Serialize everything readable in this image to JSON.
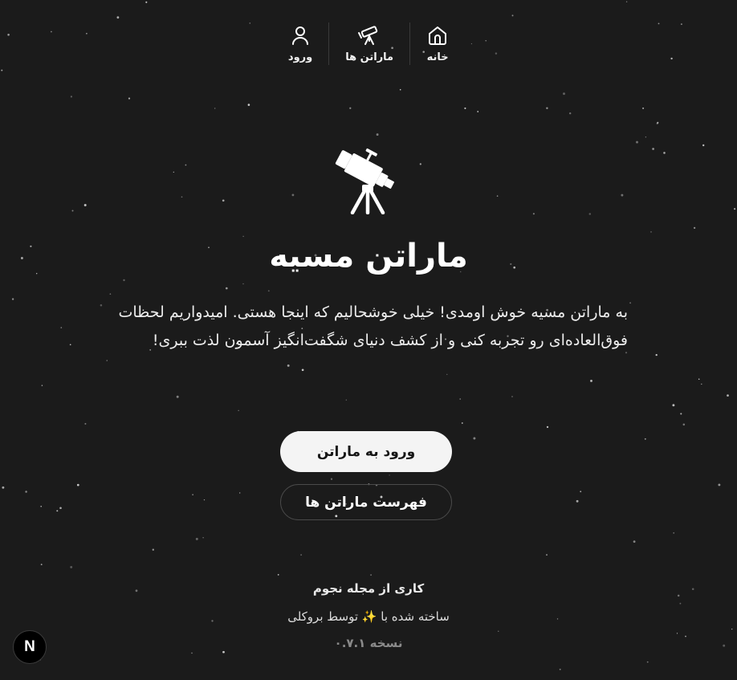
{
  "nav": {
    "items": [
      {
        "label": "خانه",
        "icon": "home-icon"
      },
      {
        "label": "ماراتن ها",
        "icon": "telescope-icon"
      },
      {
        "label": "ورود",
        "icon": "user-icon"
      }
    ]
  },
  "hero": {
    "icon": "telescope-icon",
    "title": "ماراتن مسیه",
    "description": "به ماراتن مسیه خوش اومدی! خیلی خوشحالیم که اینجا هستی. امیدواریم لحظات فوق‌العاده‌ای رو تجربه کنی و از کشف دنیای شگفت‌انگیز آسمون لذت ببری!"
  },
  "buttons": {
    "primary_label": "ورود به ماراتن",
    "secondary_label": "فهرست ماراتن ها"
  },
  "footer": {
    "credit": "کاری از مجله نجوم",
    "built_prefix": "ساخته شده با",
    "built_emoji": "✨",
    "built_suffix": "توسط بروکلی",
    "version": "نسخه ۰.۷.۱"
  },
  "next_badge": {
    "label": "N"
  },
  "colors": {
    "background": "#1b1b1b",
    "primary_button": "#f4f4f4",
    "text": "#ffffff",
    "muted": "#8a8a8a"
  }
}
